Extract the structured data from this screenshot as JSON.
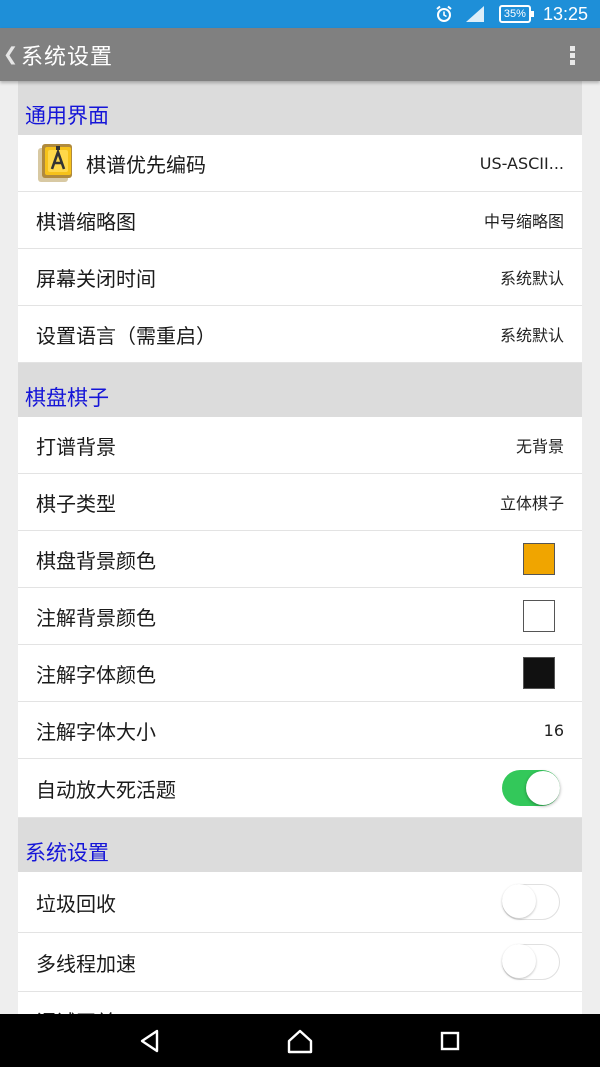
{
  "status_bar": {
    "time": "13:25",
    "battery": "35%",
    "icons": [
      "alarm-icon",
      "signal-icon",
      "battery-icon"
    ]
  },
  "app_bar": {
    "title": "系统设置",
    "back_icon": "back-chevron-icon",
    "more_icon": "more-vert-icon"
  },
  "sections": {
    "general": {
      "header": "通用界面",
      "rows": [
        {
          "label": "棋谱优先编码",
          "value": "US-ASCII..."
        },
        {
          "label": "棋谱缩略图",
          "value": "中号缩略图"
        },
        {
          "label": "屏幕关闭时间",
          "value": "系统默认"
        },
        {
          "label": "设置语言（需重启）",
          "value": "系统默认"
        }
      ]
    },
    "board": {
      "header": "棋盘棋子",
      "rows": [
        {
          "label": "打谱背景",
          "value": "无背景"
        },
        {
          "label": "棋子类型",
          "value": "立体棋子"
        },
        {
          "label": "棋盘背景颜色",
          "color": "#f0a500"
        },
        {
          "label": "注解背景颜色",
          "color": "#ffffff"
        },
        {
          "label": "注解字体颜色",
          "color": "#111111"
        },
        {
          "label": "注解字体大小",
          "value": "16"
        },
        {
          "label": "自动放大死活题",
          "toggle": true
        }
      ]
    },
    "system": {
      "header": "系统设置",
      "rows": [
        {
          "label": "垃圾回收",
          "toggle": false
        },
        {
          "label": "多线程加速",
          "toggle": false
        },
        {
          "label": "调试开关"
        }
      ]
    }
  },
  "colors": {
    "status_bar": "#1e8fd8",
    "app_bar": "#808080",
    "section_header_text": "#1515d8",
    "toggle_on": "#33c85a"
  }
}
